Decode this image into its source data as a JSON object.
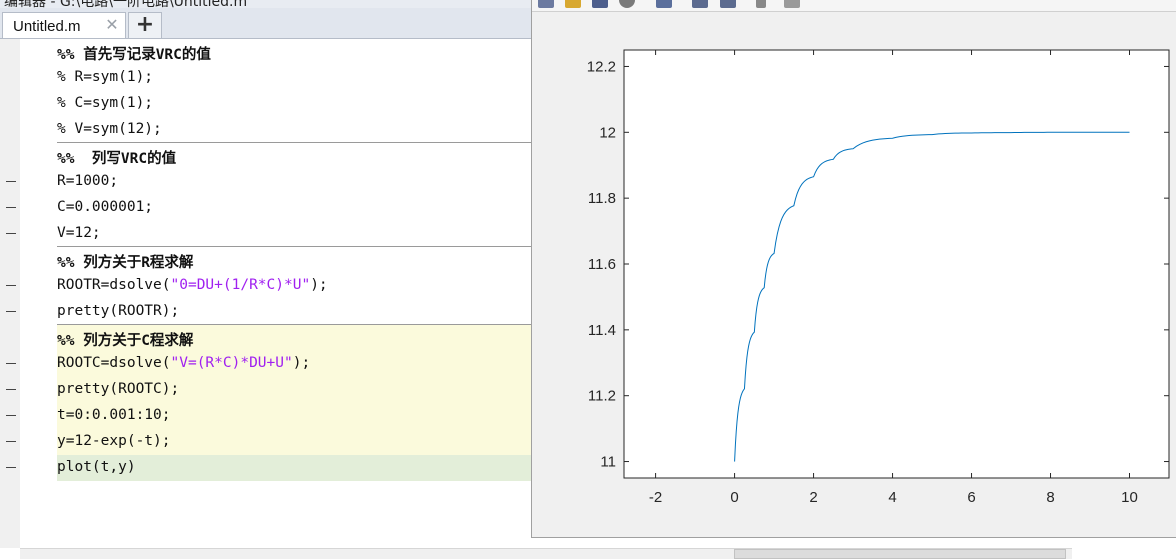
{
  "editor": {
    "title": "编辑器 - G:\\电路\\一阶电路\\Untitled.m",
    "tab_label": "Untitled.m",
    "close_icon": "close-icon",
    "add_tab_label": "+",
    "lines": [
      {
        "text": "%% 首先写记录VRC的值",
        "kind": "head"
      },
      {
        "text": "% R=sym(1);",
        "kind": "comment"
      },
      {
        "text": "% C=sym(1);",
        "kind": "comment"
      },
      {
        "text": "% V=sym(12);",
        "kind": "comment"
      },
      {
        "text": "%%  列写VRC的值",
        "kind": "head"
      },
      {
        "text": "R=1000;",
        "kind": "code"
      },
      {
        "text": "C=0.000001;",
        "kind": "code"
      },
      {
        "text": "V=12;",
        "kind": "code"
      },
      {
        "text": "%% 列方关于R程求解",
        "kind": "head"
      },
      {
        "pre": "ROOTR=dsolve(",
        "str": "\"0=DU+(1/R*C)*U\"",
        "post": ");",
        "kind": "code"
      },
      {
        "text": "pretty(ROOTR);",
        "kind": "code"
      },
      {
        "text": "%% 列方关于C程求解",
        "kind": "head"
      },
      {
        "pre": "ROOTC=dsolve(",
        "str": "\"V=(R*C)*DU+U\"",
        "post": ");",
        "kind": "code"
      },
      {
        "text": "pretty(ROOTC);",
        "kind": "code"
      },
      {
        "text": "t=0:0.001:10;",
        "kind": "code"
      },
      {
        "text": "y=12-exp(-t);",
        "kind": "code"
      },
      {
        "text": "plot(t,y)",
        "kind": "code"
      }
    ]
  },
  "colors": {
    "section_header": "#1f8a1f",
    "comment": "#3a9a3a",
    "string": "#a020f0",
    "cell_highlight": "#fbfadc",
    "current_line": "#e3eed9",
    "plot_line": "#0072bd"
  },
  "chart_data": {
    "type": "line",
    "x_ticks": [
      "-2",
      "0",
      "2",
      "4",
      "6",
      "8",
      "10"
    ],
    "y_ticks": [
      "11",
      "11.2",
      "11.4",
      "11.6",
      "11.8",
      "12",
      "12.2"
    ],
    "xlim": [
      -2.8,
      11
    ],
    "ylim": [
      10.95,
      12.25
    ],
    "grid": false,
    "series": [
      {
        "function": "y=12-exp(-t)",
        "x": [
          0,
          0.25,
          0.5,
          0.75,
          1,
          1.5,
          2,
          2.5,
          3,
          4,
          5,
          6,
          7,
          8,
          9,
          10
        ],
        "y": [
          11,
          11.221,
          11.393,
          11.528,
          11.632,
          11.777,
          11.865,
          11.918,
          11.95,
          11.982,
          11.993,
          11.998,
          11.999,
          12.0,
          12.0,
          12.0
        ]
      }
    ]
  }
}
